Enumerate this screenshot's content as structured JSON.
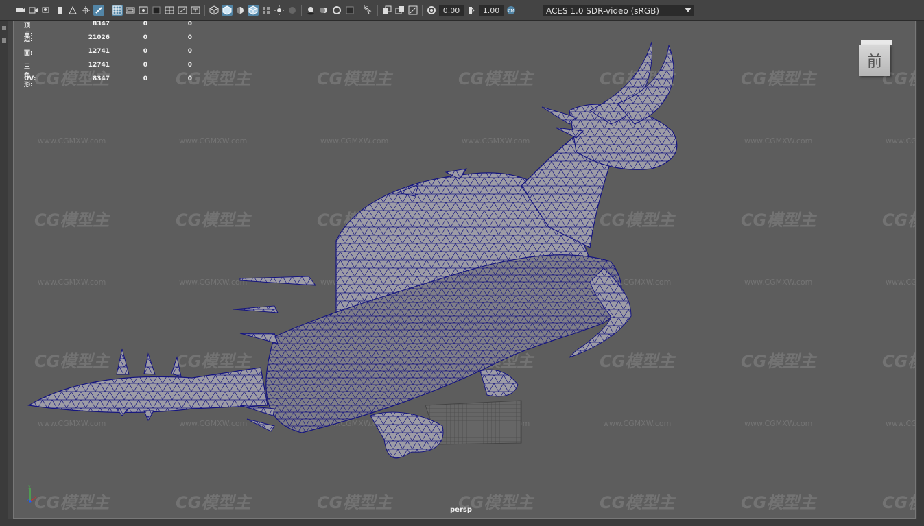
{
  "toolbar": {
    "exposure_value": "0.00",
    "gamma_value": "1.00",
    "color_space": "ACES 1.0 SDR-video (sRGB)",
    "accent_color": "#5285a6"
  },
  "hud": {
    "rows": [
      {
        "label": "顶点:",
        "v1": "8347",
        "v2": "0",
        "v3": "0"
      },
      {
        "label": "边:",
        "v1": "21026",
        "v2": "0",
        "v3": "0"
      },
      {
        "label": "面:",
        "v1": "12741",
        "v2": "0",
        "v3": "0"
      },
      {
        "label": "三角形:",
        "v1": "12741",
        "v2": "0",
        "v3": "0"
      },
      {
        "label": "UV:",
        "v1": "8347",
        "v2": "0",
        "v3": "0"
      }
    ]
  },
  "viewport": {
    "camera_label": "persp",
    "view_cube_label": "前",
    "background_color": "#5d5d5d",
    "wireframe_color": "#1a1a9a",
    "watermark_text": "CG模型主",
    "watermark_url": "www.CGMXW.com"
  },
  "axis": {
    "x": "x",
    "y": "y",
    "z": "z"
  }
}
